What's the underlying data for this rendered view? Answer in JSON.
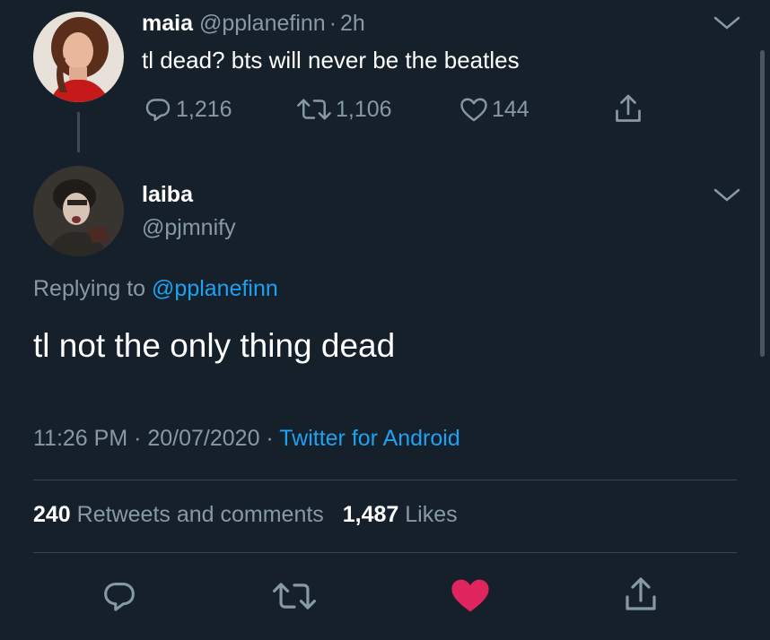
{
  "parent_tweet": {
    "display_name": "maia",
    "handle": "@pplanefinn",
    "separator": "·",
    "time": "2h",
    "text": "tl dead? bts will never be the beatles",
    "reply_count": "1,216",
    "retweet_count": "1,106",
    "like_count": "144"
  },
  "main_tweet": {
    "display_name": "laiba",
    "handle": "@pjmnify",
    "replying_prefix": "Replying to",
    "replying_handle": "@pplanefinn",
    "text": "tl not the only thing dead",
    "timestamp": "11:26 PM · 20/07/2020 ·",
    "source": "Twitter for Android",
    "retweets_count": "240",
    "retweets_label": "Retweets and comments",
    "likes_count": "1,487",
    "likes_label": "Likes"
  },
  "colors": {
    "background": "#15202b",
    "muted": "#8899a6",
    "link": "#1da1f2",
    "like_active": "#e0245e",
    "divider": "#38444d"
  },
  "icons": {
    "reply": "reply-icon",
    "retweet": "retweet-icon",
    "like": "heart-icon",
    "share": "share-icon",
    "more": "chevron-down-icon"
  }
}
